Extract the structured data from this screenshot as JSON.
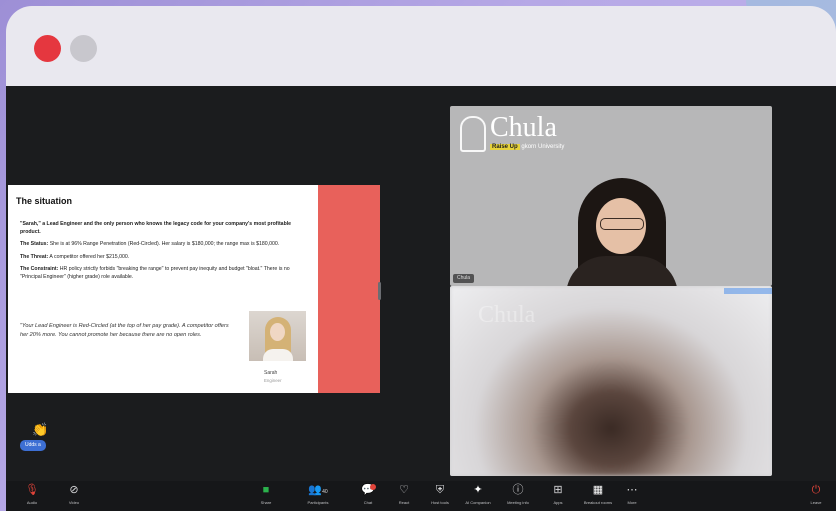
{
  "window": {
    "controls": [
      "close-dot",
      "minimize-dot"
    ]
  },
  "slide": {
    "title": "The situation",
    "p1": "\"Sarah,\" a Lead Engineer and the only person who knows the legacy code for your company's most profitable product.",
    "p2_label": "The Status:",
    "p2": " She is at 96% Range Penetration (Red-Circled). Her salary is $180,000; the range max is $180,000.",
    "p3_label": "The Threat:",
    "p3": " A competitor offered her $215,000.",
    "p4_label": "The Constraint:",
    "p4": " HR policy strictly forbids \"breaking the range\" to prevent pay inequity and budget \"bloat.\" There is no \"Principal Engineer\" (higher grade) role available.",
    "quote": "\"Your Lead Engineer is Red-Circled (at the top of her pay grade). A competitor offers her 20% more. You cannot promote her because there are no open roles.",
    "photo_name": "Sarah",
    "photo_role": "Engineer",
    "accent_color": "#e8615b"
  },
  "reaction": {
    "emoji": "👏",
    "chip": "Udds a"
  },
  "tiles": {
    "tile1": {
      "logo_text": "Chula",
      "logo_tag": "Raise Up",
      "logo_sub": " gkorn University",
      "label": "Chula"
    },
    "tile2": {
      "ghost_text": "Chula"
    }
  },
  "toolbar": {
    "audio": "Audio",
    "video": "Video",
    "share": "Share",
    "participants": "Participants",
    "participants_count": "40",
    "chat": "Chat",
    "react": "React",
    "host_tools": "Host tools",
    "ai_companion": "AI Companion",
    "meeting_info": "Meeting info",
    "apps": "Apps",
    "breakout_rooms": "Breakout rooms",
    "more": "More",
    "leave": "Leave"
  }
}
